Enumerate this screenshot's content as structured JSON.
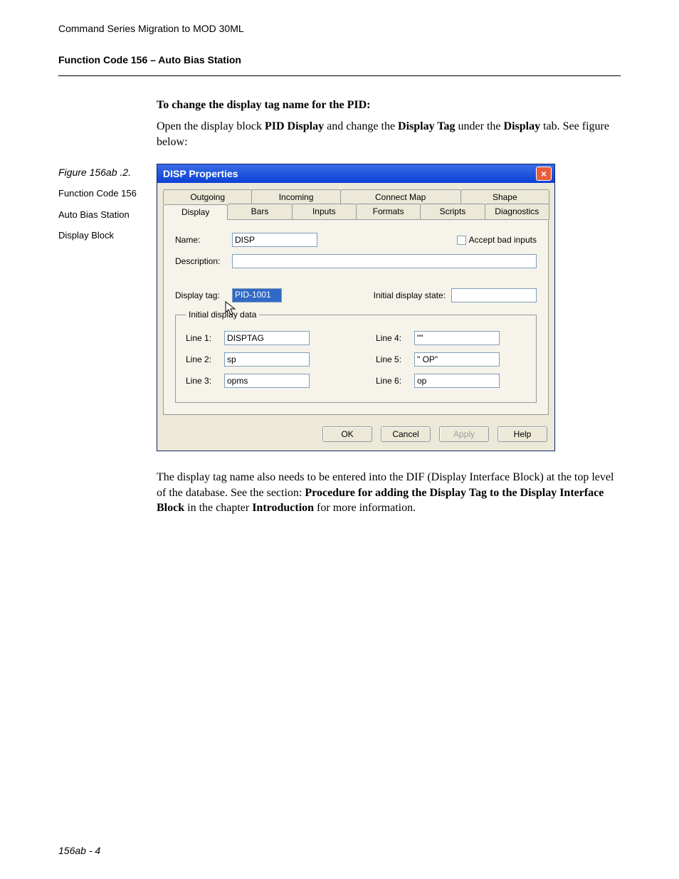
{
  "header": {
    "running": "Command Series Migration to MOD 30ML",
    "section": "Function Code 156 – Auto Bias Station"
  },
  "intro": {
    "heading": "To change the display tag name for the PID:",
    "p_a": "Open the display block ",
    "p_b": "PID Display",
    "p_c": " and change the ",
    "p_d": "Display Tag",
    "p_e": " under the ",
    "p_f": "Display",
    "p_g": " tab. See figure below:"
  },
  "aside": {
    "figlabel": "Figure 156ab .2.",
    "line1": "Function Code 156",
    "line2": "Auto Bias Station",
    "line3": "Display Block"
  },
  "win": {
    "title": "DISP Properties",
    "tabs_row1": [
      "Outgoing",
      "Incoming",
      "Connect Map",
      "Shape"
    ],
    "tabs_row2": [
      "Display",
      "Bars",
      "Inputs",
      "Formats",
      "Scripts",
      "Diagnostics"
    ],
    "labels": {
      "name": "Name:",
      "description": "Description:",
      "accept": "Accept bad inputs",
      "display_tag": "Display tag:",
      "initial_state": "Initial display state:",
      "fieldset": "Initial display data",
      "line1": "Line 1:",
      "line2": "Line 2:",
      "line3": "Line 3:",
      "line4": "Line 4:",
      "line5": "Line 5:",
      "line6": "Line 6:"
    },
    "values": {
      "name": "DISP",
      "description": "",
      "display_tag": "PID-1001",
      "initial_state": "",
      "line1": "DISPTAG",
      "line2": "sp",
      "line3": "opms",
      "line4": "\"\"",
      "line5": "\" OP\"",
      "line6": "op"
    },
    "buttons": {
      "ok": "OK",
      "cancel": "Cancel",
      "apply": "Apply",
      "help": "Help"
    }
  },
  "outro": {
    "a": "The display tag name also needs to be entered into the DIF (Display Interface Block) at the top level of the database. See the section: ",
    "b": "Procedure for adding the Display Tag to the Display Interface Block",
    "c": " in the chapter ",
    "d": "Introduction",
    "e": " for more information."
  },
  "footer": "156ab - 4"
}
